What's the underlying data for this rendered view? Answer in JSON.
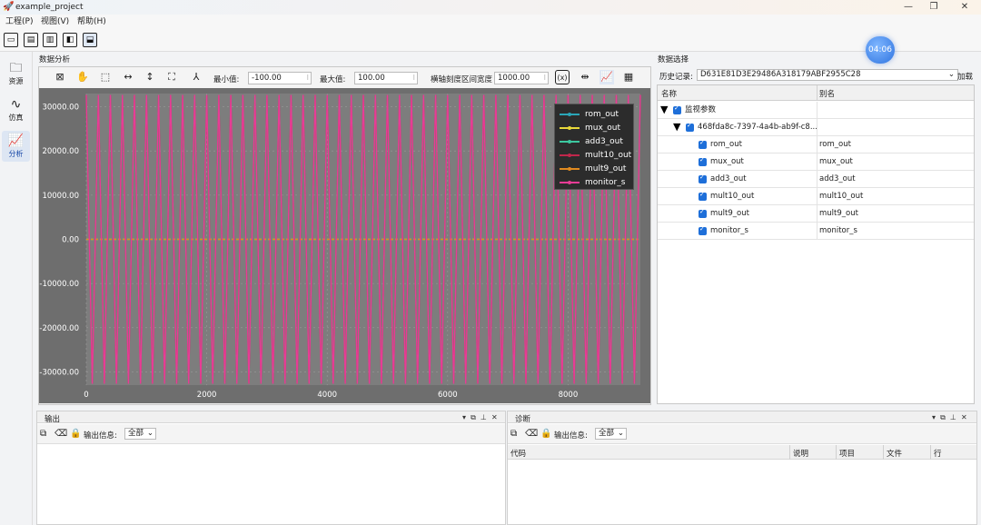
{
  "window": {
    "title": "example_project"
  },
  "menu": [
    {
      "label": "工程(P)"
    },
    {
      "label": "视图(V)"
    },
    {
      "label": "帮助(H)"
    }
  ],
  "timer": "04:06",
  "sidebar": [
    {
      "label": "资源",
      "icon": "folder-icon"
    },
    {
      "label": "仿真",
      "icon": "wave-icon"
    },
    {
      "label": "分析",
      "icon": "chart-icon",
      "active": true
    }
  ],
  "analysis": {
    "panel_title": "数据分析",
    "min_label": "最小值:",
    "min_value": "-100.00",
    "max_label": "最大值:",
    "max_value": "100.00",
    "width_label": "横轴刻度区间宽度",
    "width_value": "1000.00"
  },
  "chart_data": {
    "type": "line",
    "xlim": [
      0,
      9200
    ],
    "ylim": [
      -33000,
      33000
    ],
    "xticks": [
      0,
      2000,
      4000,
      6000,
      8000
    ],
    "yticks": [
      30000,
      20000,
      10000,
      0,
      -10000,
      -20000,
      -30000
    ],
    "ytick_labels": [
      "30000.00",
      "20000.00",
      "10000.00",
      "0.00",
      "-10000.00",
      "-20000.00",
      "-30000.00"
    ],
    "grid": true,
    "legend_position": "top-right",
    "series": [
      {
        "name": "rom_out",
        "color": "#2aa6b8",
        "kind": "flat",
        "value": 0
      },
      {
        "name": "mux_out",
        "color": "#e8d83a",
        "kind": "flat",
        "value": 0
      },
      {
        "name": "add3_out",
        "color": "#3cc8a0",
        "kind": "flat",
        "value": 0
      },
      {
        "name": "mult10_out",
        "color": "#c0274b",
        "kind": "oscillating",
        "amplitude": 32700,
        "period": 200
      },
      {
        "name": "mult9_out",
        "color": "#e08a20",
        "kind": "flat",
        "value": 0
      },
      {
        "name": "monitor_s",
        "color": "#e83c96",
        "kind": "oscillating",
        "amplitude": 32700,
        "period": 200
      }
    ]
  },
  "selection": {
    "panel_title": "数据选择",
    "history_label": "历史记录:",
    "history_value": "D631E81D3E29486A318179ABF2955C28",
    "load_label": "加载",
    "col_name": "名称",
    "col_alias": "别名",
    "root": "监视参数",
    "group": "468fda8c-7397-4a4b-ab9f-c8...",
    "rows": [
      {
        "name": "rom_out",
        "alias": "rom_out"
      },
      {
        "name": "mux_out",
        "alias": "mux_out"
      },
      {
        "name": "add3_out",
        "alias": "add3_out"
      },
      {
        "name": "mult10_out",
        "alias": "mult10_out"
      },
      {
        "name": "mult9_out",
        "alias": "mult9_out"
      },
      {
        "name": "monitor_s",
        "alias": "monitor_s"
      }
    ]
  },
  "output": {
    "title": "输出",
    "info_label": "输出信息:",
    "filter_value": "全部"
  },
  "diagnostics": {
    "title": "诊断",
    "info_label": "输出信息:",
    "filter_value": "全部",
    "columns": [
      "代码",
      "说明",
      "项目",
      "文件",
      "行"
    ]
  }
}
